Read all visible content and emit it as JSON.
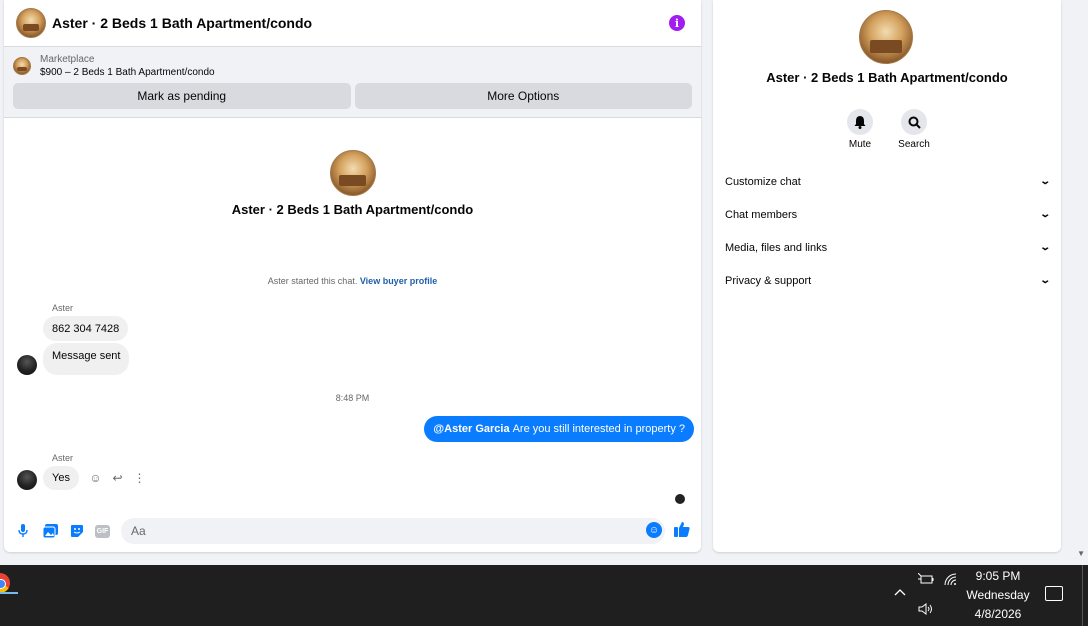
{
  "chat": {
    "header_title": "Aster · 2 Beds 1 Bath Apartment/condo",
    "info_icon": "i",
    "marketplace": {
      "label": "Marketplace",
      "listing": "$900 – 2 Beds 1 Bath Apartment/condo",
      "mark_pending": "Mark as pending",
      "more_options": "More Options"
    },
    "profile_name": "Aster · 2 Beds 1 Bath Apartment/condo",
    "started_text": "Aster started this chat.",
    "view_buyer_profile": "View buyer profile",
    "messages": [
      {
        "sender": "Aster",
        "text": "862 304 7428"
      },
      {
        "text": "Message sent"
      },
      {
        "time": "8:48 PM"
      },
      {
        "mention": "@Aster Garcia",
        "text": "Are you still interested in property ?"
      },
      {
        "sender": "Aster",
        "text": "Yes"
      }
    ],
    "composer_placeholder": "Aa"
  },
  "side": {
    "title": "Aster · 2 Beds 1 Bath Apartment/condo",
    "actions": [
      {
        "label": "Mute",
        "icon": "bell-icon"
      },
      {
        "label": "Search",
        "icon": "search-icon"
      }
    ],
    "menu": [
      {
        "label": "Customize chat"
      },
      {
        "label": "Chat members"
      },
      {
        "label": "Media, files and links"
      },
      {
        "label": "Privacy & support"
      }
    ]
  },
  "taskbar": {
    "time": "9:05 PM",
    "day": "Wednesday",
    "date": "4/8/2026"
  },
  "colors": {
    "accent": "#0a7cff",
    "info": "#a21ef0"
  }
}
